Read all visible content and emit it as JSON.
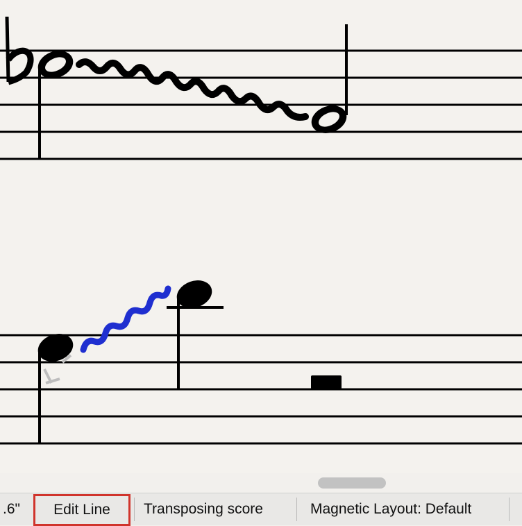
{
  "colors": {
    "paper": "#f4f2ee",
    "ink": "#000000",
    "selection": "#1f2fd0",
    "highlight_box": "#d0342c",
    "status_bar_bg": "#e9e8e6"
  },
  "status_bar": {
    "page_size": ".6\"",
    "edit_mode": "Edit Line",
    "transposing": "Transposing score",
    "magnetic_layout": "Magnetic Layout: Default"
  }
}
